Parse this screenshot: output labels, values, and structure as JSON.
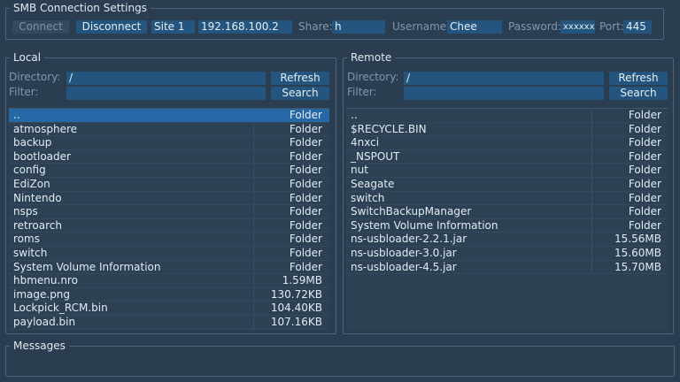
{
  "connection": {
    "title": "SMB Connection Settings",
    "connect_label": "Connect",
    "disconnect_label": "Disconnect",
    "site": "Site 1",
    "host": "192.168.100.2",
    "share_label": "Share:",
    "share": "h",
    "username_label": "Username:",
    "username": "Chee",
    "password_label": "Password:",
    "password": "xxxxxx",
    "port_label": "Port:",
    "port": "445"
  },
  "local": {
    "title": "Local",
    "directory_label": "Directory:",
    "directory": "/",
    "filter_label": "Filter:",
    "filter": "",
    "refresh_label": "Refresh",
    "search_label": "Search",
    "files": [
      {
        "name": "..",
        "type": "Folder"
      },
      {
        "name": "atmosphere",
        "type": "Folder"
      },
      {
        "name": "backup",
        "type": "Folder"
      },
      {
        "name": "bootloader",
        "type": "Folder"
      },
      {
        "name": "config",
        "type": "Folder"
      },
      {
        "name": "EdiZon",
        "type": "Folder"
      },
      {
        "name": "Nintendo",
        "type": "Folder"
      },
      {
        "name": "nsps",
        "type": "Folder"
      },
      {
        "name": "retroarch",
        "type": "Folder"
      },
      {
        "name": "roms",
        "type": "Folder"
      },
      {
        "name": "switch",
        "type": "Folder"
      },
      {
        "name": "System Volume Information",
        "type": "Folder"
      },
      {
        "name": "hbmenu.nro",
        "type": "1.59MB"
      },
      {
        "name": "image.png",
        "type": "130.72KB"
      },
      {
        "name": "Lockpick_RCM.bin",
        "type": "104.40KB"
      },
      {
        "name": "payload.bin",
        "type": "107.16KB"
      }
    ]
  },
  "remote": {
    "title": "Remote",
    "directory_label": "Directory:",
    "directory": "/",
    "filter_label": "Filter:",
    "filter": "",
    "refresh_label": "Refresh",
    "search_label": "Search",
    "files": [
      {
        "name": "..",
        "type": "Folder"
      },
      {
        "name": "$RECYCLE.BIN",
        "type": "Folder"
      },
      {
        "name": "4nxci",
        "type": "Folder"
      },
      {
        "name": "_NSPOUT",
        "type": "Folder"
      },
      {
        "name": "nut",
        "type": "Folder"
      },
      {
        "name": "Seagate",
        "type": "Folder"
      },
      {
        "name": "switch",
        "type": "Folder"
      },
      {
        "name": "SwitchBackupManager",
        "type": "Folder"
      },
      {
        "name": "System Volume Information",
        "type": "Folder"
      },
      {
        "name": "ns-usbloader-2.2.1.jar",
        "type": "15.56MB"
      },
      {
        "name": "ns-usbloader-3.0.jar",
        "type": "15.60MB"
      },
      {
        "name": "ns-usbloader-4.5.jar",
        "type": "15.70MB"
      }
    ]
  },
  "messages": {
    "title": "Messages",
    "text": ""
  },
  "colors": {
    "background": "#2b3e51",
    "button": "#23557e",
    "selected_row": "#2668a6",
    "label": "#7f98b0"
  }
}
